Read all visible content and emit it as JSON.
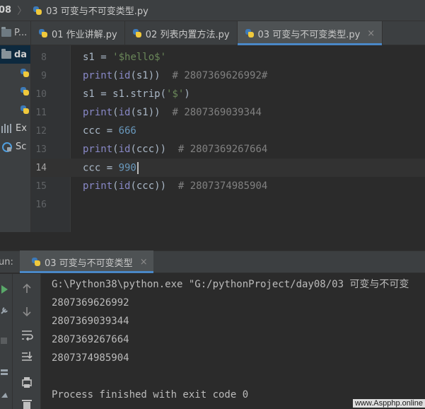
{
  "breadcrumb": {
    "folder": "08",
    "file": "03 可变与不可变类型.py"
  },
  "project_panel": {
    "header": "P...",
    "root": "da",
    "tree_items": [
      "",
      "",
      ""
    ],
    "external_libraries": "Ex",
    "scratches": "Sc"
  },
  "editor_tabs": [
    {
      "label": "01 作业讲解.py",
      "active": false
    },
    {
      "label": "02 列表内置方法.py",
      "active": false
    },
    {
      "label": "03 可变与不可变类型.py",
      "active": true
    }
  ],
  "close_glyph": "×",
  "editor": {
    "lines": [
      {
        "num": "8",
        "tokens": [
          {
            "t": "var",
            "v": "s1 = "
          },
          {
            "t": "str",
            "v": "'$hello$'"
          }
        ]
      },
      {
        "num": "9",
        "tokens": [
          {
            "t": "func",
            "v": "print"
          },
          {
            "t": "var",
            "v": "("
          },
          {
            "t": "func",
            "v": "id"
          },
          {
            "t": "var",
            "v": "(s1))  "
          },
          {
            "t": "comment",
            "v": "# 2807369626992#"
          }
        ]
      },
      {
        "num": "10",
        "tokens": [
          {
            "t": "var",
            "v": "s1 = s1.strip("
          },
          {
            "t": "str",
            "v": "'$'"
          },
          {
            "t": "var",
            "v": ")"
          }
        ]
      },
      {
        "num": "11",
        "tokens": [
          {
            "t": "func",
            "v": "print"
          },
          {
            "t": "var",
            "v": "("
          },
          {
            "t": "func",
            "v": "id"
          },
          {
            "t": "var",
            "v": "(s1))  "
          },
          {
            "t": "comment",
            "v": "# 2807369039344"
          }
        ]
      },
      {
        "num": "12",
        "tokens": [
          {
            "t": "var",
            "v": "ccc = "
          },
          {
            "t": "num",
            "v": "666"
          }
        ]
      },
      {
        "num": "13",
        "tokens": [
          {
            "t": "func",
            "v": "print"
          },
          {
            "t": "var",
            "v": "("
          },
          {
            "t": "func",
            "v": "id"
          },
          {
            "t": "var",
            "v": "(ccc))  "
          },
          {
            "t": "comment",
            "v": "# 2807369267664"
          }
        ]
      },
      {
        "num": "14",
        "tokens": [
          {
            "t": "var",
            "v": "ccc = "
          },
          {
            "t": "num",
            "v": "990"
          }
        ],
        "current": true
      },
      {
        "num": "15",
        "tokens": [
          {
            "t": "func",
            "v": "print"
          },
          {
            "t": "var",
            "v": "("
          },
          {
            "t": "func",
            "v": "id"
          },
          {
            "t": "var",
            "v": "(ccc))  "
          },
          {
            "t": "comment",
            "v": "# 2807374985904"
          }
        ]
      },
      {
        "num": "16",
        "tokens": []
      }
    ]
  },
  "run_panel": {
    "label": "un:",
    "tab_label": "03 可变与不可变类型",
    "console_lines": [
      "G:\\Python38\\python.exe \"G:/pythonProject/day08/03 可变与不可变",
      "2807369626992",
      "2807369039344",
      "2807369267664",
      "2807374985904",
      "",
      "Process finished with exit code 0"
    ]
  },
  "watermark": "www.Aspphp.online",
  "colors": {
    "background": "#2b2b2b",
    "panel": "#3c3f41",
    "accent": "#4a88c7",
    "string": "#6a8759",
    "number": "#6897bb",
    "builtin": "#8888c6",
    "comment": "#808080",
    "run_green": "#59a869"
  }
}
